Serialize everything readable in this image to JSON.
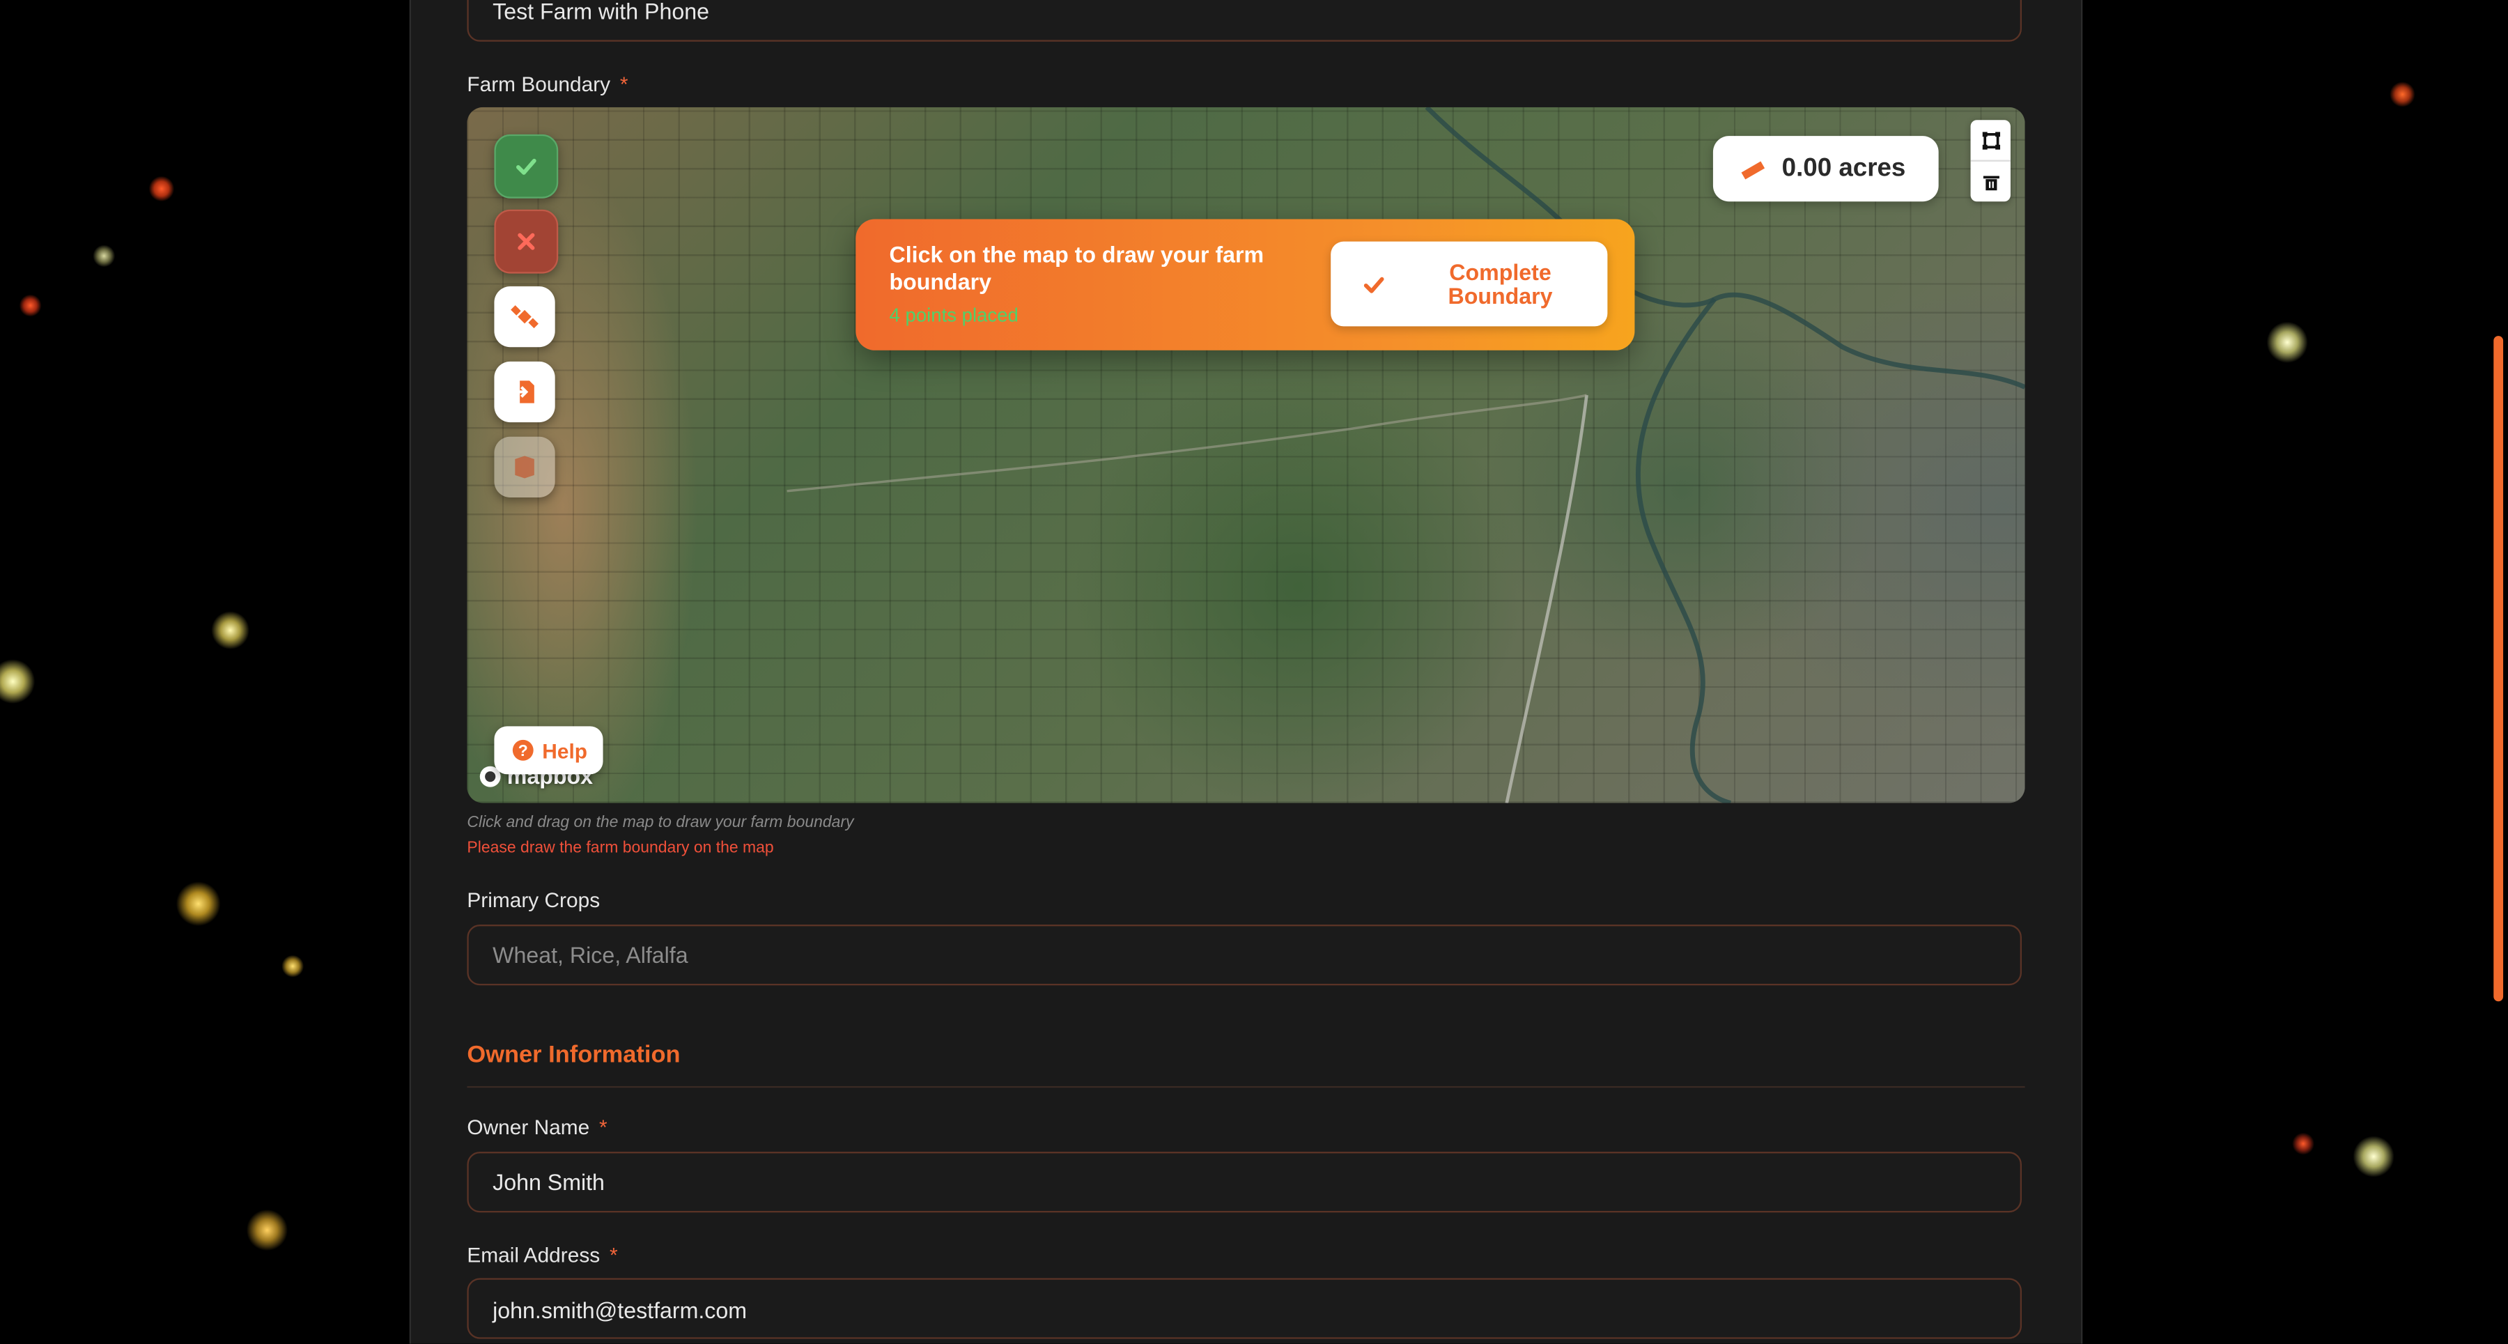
{
  "colors": {
    "accent": "#f06a2c",
    "background": "#000000",
    "panel": "#1a1a1a",
    "success": "#4fd16a",
    "error": "#f0503a"
  },
  "farm_name": {
    "value": "Test Farm with Phone"
  },
  "farm_boundary": {
    "label": "Farm Boundary",
    "required": "*",
    "map": {
      "banner_title": "Click on the map to draw your farm boundary",
      "banner_sub": "4 points placed",
      "complete_button": "Complete Boundary",
      "acres": "0.00 acres",
      "help": "Help",
      "attribution": "mapbox",
      "tools": [
        {
          "icon": "check-icon",
          "state": "confirm"
        },
        {
          "icon": "close-icon",
          "state": "cancel"
        },
        {
          "icon": "satellite-icon",
          "state": "locate"
        },
        {
          "icon": "import-file-icon",
          "state": "import"
        },
        {
          "icon": "map-layer-icon",
          "state": "disabled"
        }
      ],
      "controls": [
        "polygon-icon",
        "trash-icon"
      ]
    },
    "hint": "Click and drag on the map to draw your farm boundary",
    "error": "Please draw the farm boundary on the map"
  },
  "primary_crops": {
    "label": "Primary Crops",
    "placeholder": "Wheat, Rice, Alfalfa"
  },
  "owner_section": {
    "title": "Owner Information"
  },
  "owner_name": {
    "label": "Owner Name",
    "required": "*",
    "value": "John Smith"
  },
  "email": {
    "label": "Email Address",
    "required": "*",
    "value": "john.smith@testfarm.com"
  }
}
